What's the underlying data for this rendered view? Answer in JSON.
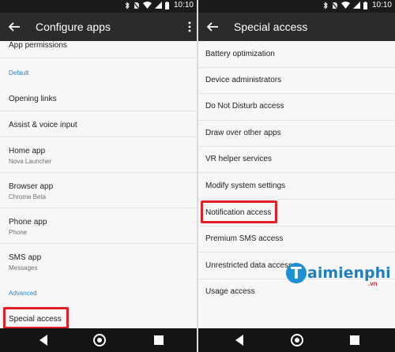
{
  "status": {
    "time": "10:10"
  },
  "left": {
    "title": "Configure apps",
    "items": [
      {
        "label": "App permissions"
      },
      {
        "label": "Opening links"
      },
      {
        "label": "Assist & voice input"
      },
      {
        "label": "Home app",
        "sub": "Nova Launcher"
      },
      {
        "label": "Browser app",
        "sub": "Chrome Beta"
      },
      {
        "label": "Phone app",
        "sub": "Phone"
      },
      {
        "label": "SMS app",
        "sub": "Messages"
      },
      {
        "label": "Special access"
      }
    ],
    "sections": {
      "default": "Default",
      "advanced": "Advanced"
    }
  },
  "right": {
    "title": "Special access",
    "items": [
      {
        "label": "Battery optimization"
      },
      {
        "label": "Device administrators"
      },
      {
        "label": "Do Not Disturb access"
      },
      {
        "label": "Draw over other apps"
      },
      {
        "label": "VR helper services"
      },
      {
        "label": "Modify system settings"
      },
      {
        "label": "Notification access"
      },
      {
        "label": "Premium SMS access"
      },
      {
        "label": "Unrestricted data access"
      },
      {
        "label": "Usage access"
      }
    ]
  },
  "watermark": {
    "letter": "T",
    "text": "aimienphi",
    "suffix": ".vn"
  },
  "colors": {
    "highlight": "#e31e24",
    "section": "#2f82c9",
    "appbar": "#2b2b2b"
  }
}
